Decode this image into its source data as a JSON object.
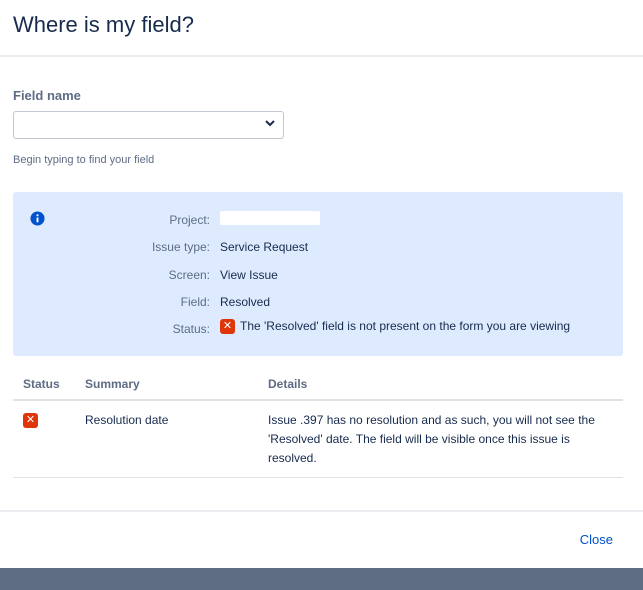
{
  "dialog": {
    "title": "Where is my field?",
    "close_label": "Close"
  },
  "form": {
    "field_label": "Field name",
    "field_value": "",
    "help_text": "Begin typing to find your field"
  },
  "info": {
    "project_label": "Project:",
    "project_value": "",
    "issue_type_label": "Issue type:",
    "issue_type_value": "Service Request",
    "screen_label": "Screen:",
    "screen_value": "View Issue",
    "field_label": "Field:",
    "field_value": "Resolved",
    "status_label": "Status:",
    "status_value": "The 'Resolved' field is not present on the form you are viewing"
  },
  "table": {
    "headers": [
      "Status",
      "Summary",
      "Details"
    ],
    "rows": [
      {
        "status": "error",
        "summary": "Resolution date",
        "details": "Issue         .397 has no resolution and as such, you will not see the 'Resolved' date. The field will be visible once this issue is resolved."
      }
    ]
  },
  "colors": {
    "accent": "#0052cc",
    "info_bg": "#deebff",
    "error": "#de350b"
  }
}
